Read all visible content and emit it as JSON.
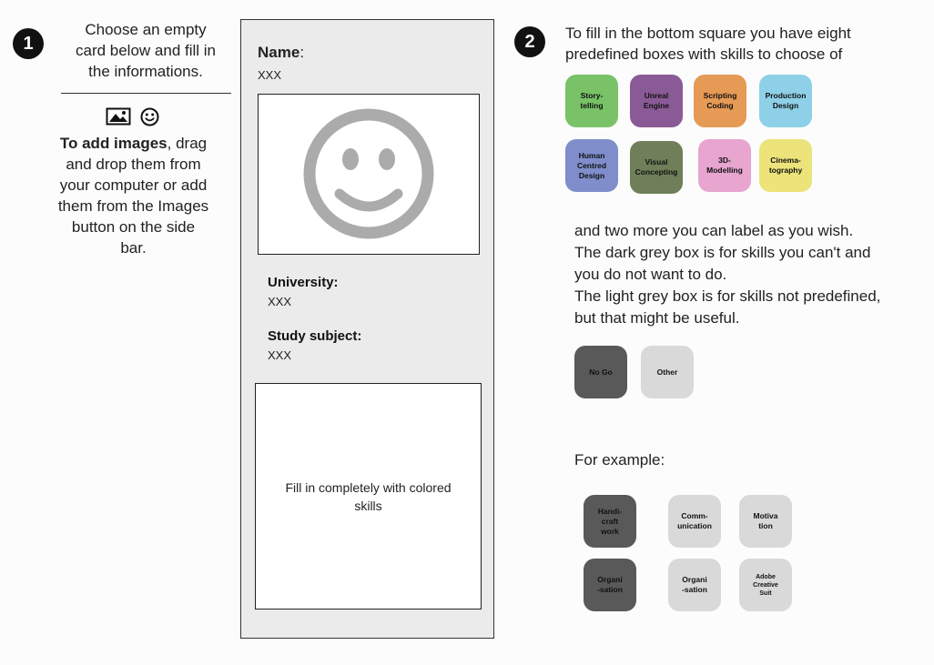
{
  "step1": {
    "badge": "1",
    "instruction": "Choose an empty\ncard  below and fill in\nthe informations.",
    "images_icon": "image-icon",
    "emoji_icon": "smiley-icon",
    "hint_bold": "To add images",
    "hint_rest": ", drag\nand drop them from\nyour computer or add\nthem from the Images\nbutton on the side\nbar."
  },
  "card": {
    "name_label": "Name",
    "name_colon": ":",
    "name_value": "XXX",
    "photo_icon": "smiley-face-icon",
    "university_label": "University:",
    "university_value": "XXX",
    "study_label": "Study subject:",
    "study_value": "XXX",
    "skills_placeholder": "Fill in completely with colored\nskills"
  },
  "step2": {
    "badge": "2",
    "intro": "To fill in the bottom square you have eight\npredefined boxes with skills to choose of",
    "predefined_skills": [
      {
        "label": "Story-\ntelling",
        "color": "#79c267"
      },
      {
        "label": "Unreal\nEngine",
        "color": "#8a5a96"
      },
      {
        "label": "Scripting\nCoding",
        "color": "#e59a55"
      },
      {
        "label": "Production\nDesign",
        "color": "#8ed0e7"
      },
      {
        "label": "Human\nCentred\nDesign",
        "color": "#7f8ecb"
      },
      {
        "label": "Visual\nConcepting",
        "color": "#6f7f59"
      },
      {
        "label": "3D-\nModelling",
        "color": "#e7a5cf"
      },
      {
        "label": "Cinema-\ntography",
        "color": "#ece37a"
      }
    ],
    "custom_text": "and two more you can label as you wish.\nThe dark grey box is for skills you can't and\nyou do not want to do.\nThe light grey box is for skills not predefined,\nbut that might be useful.",
    "custom_skills": [
      {
        "label": "No Go",
        "color": "#595959"
      },
      {
        "label": "Other",
        "color": "#d9d9d9"
      }
    ],
    "example_label": "For example:",
    "example_skills": [
      {
        "label": "Handi-\ncraft\nwork",
        "color": "#595959"
      },
      {
        "label": "Comm-\nunication",
        "color": "#d9d9d9"
      },
      {
        "label": "Motiva\ntion",
        "color": "#d9d9d9"
      },
      {
        "label": "Organi\n-sation",
        "color": "#595959"
      },
      {
        "label": "Organi\n-sation",
        "color": "#d9d9d9"
      },
      {
        "label": "Adobe\nCreative\nSuit",
        "color": "#d9d9d9"
      }
    ]
  }
}
